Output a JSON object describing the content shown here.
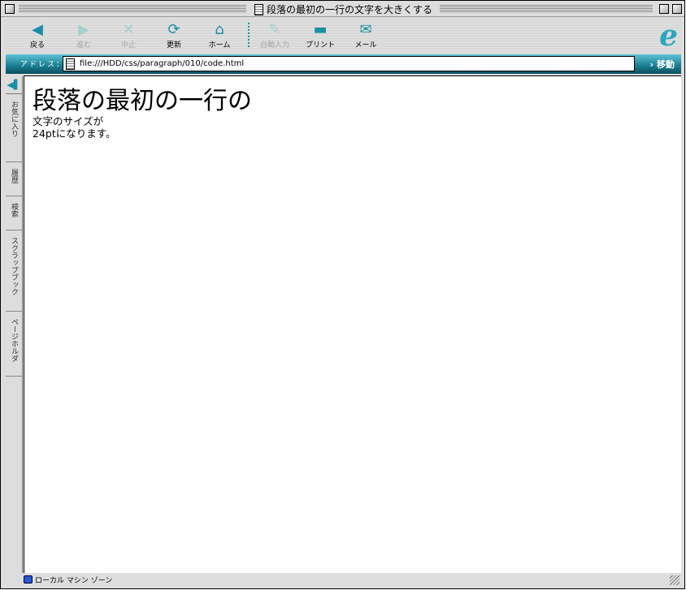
{
  "window": {
    "title": "段落の最初の一行の文字を大きくする"
  },
  "toolbar": {
    "buttons": [
      {
        "label": "戻る",
        "icon": "back-arrow-icon",
        "enabled": true
      },
      {
        "label": "進む",
        "icon": "forward-arrow-icon",
        "enabled": false
      },
      {
        "label": "中止",
        "icon": "stop-icon",
        "enabled": false
      },
      {
        "label": "更新",
        "icon": "refresh-icon",
        "enabled": true
      },
      {
        "label": "ホーム",
        "icon": "home-icon",
        "enabled": true
      },
      {
        "label": "自動入力",
        "icon": "autofill-icon",
        "enabled": false
      },
      {
        "label": "プリント",
        "icon": "print-icon",
        "enabled": true
      },
      {
        "label": "メール",
        "icon": "mail-icon",
        "enabled": true
      }
    ]
  },
  "address": {
    "label": "アドレス：",
    "url": "file:///HDD/css/paragraph/010/code.html",
    "go": "移動"
  },
  "sidebar": {
    "tabs": [
      "お気に入り",
      "履歴",
      "検索",
      "スクラップブック",
      "ページホルダ"
    ]
  },
  "content": {
    "first_line": "段落の最初の一行の",
    "line2": "文字のサイズが",
    "line3": "24ptになります。"
  },
  "status": {
    "zone": "ローカル マシン ゾーン"
  },
  "colors": {
    "accent": "#1a8fa6"
  }
}
